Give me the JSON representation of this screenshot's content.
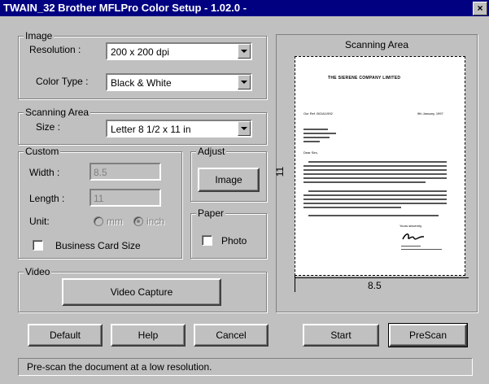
{
  "window": {
    "title": "TWAIN_32 Brother MFLPro Color Setup - 1.02.0 -",
    "close_label": "×"
  },
  "image_group": {
    "label": "Image",
    "resolution_label": "Resolution :",
    "resolution_value": "200 x 200 dpi",
    "color_type_label": "Color Type :",
    "color_type_value": "Black & White"
  },
  "scanning_area_group": {
    "label": "Scanning Area",
    "size_label": "Size :",
    "size_value": "Letter 8 1/2 x 11 in"
  },
  "custom_group": {
    "label": "Custom",
    "width_label": "Width :",
    "width_value": "8.5",
    "length_label": "Length :",
    "length_value": "11",
    "unit_label": "Unit:",
    "unit_mm": "mm",
    "unit_inch": "inch",
    "unit_selected": "inch",
    "business_card_label": "Business Card Size"
  },
  "adjust_group": {
    "label": "Adjust",
    "image_button": "Image"
  },
  "paper_group": {
    "label": "Paper",
    "photo_label": "Photo"
  },
  "video_group": {
    "label": "Video",
    "capture_button": "Video Capture"
  },
  "preview": {
    "title": "Scanning Area",
    "ruler_bottom_value": "8.5",
    "ruler_side_value": "11",
    "document": {
      "heading": "THE SIERENE COMPANY LIMITED",
      "ref_left": "Our Ref. BG/A1/992",
      "ref_right": "9th January, 1997",
      "salutation": "Dear Sirs,",
      "closing": "Yours sincerely,"
    }
  },
  "buttons": {
    "default": "Default",
    "help": "Help",
    "cancel": "Cancel",
    "start": "Start",
    "prescan": "PreScan"
  },
  "status_bar": {
    "text": "Pre-scan the document at a low resolution."
  }
}
